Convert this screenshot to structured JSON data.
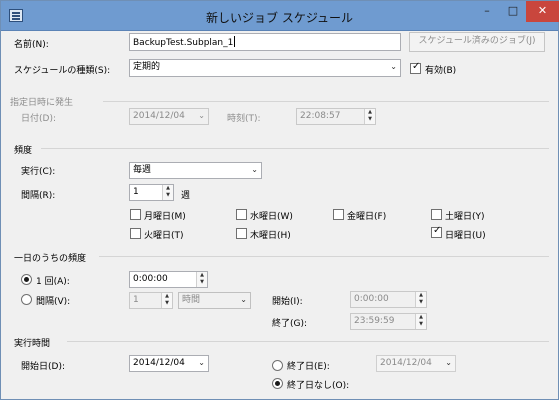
{
  "window": {
    "title": "新しいジョブ スケジュール",
    "minimize": "–",
    "maximize": "□",
    "close": "✕"
  },
  "general": {
    "name_label": "名前(N):",
    "name_value": "BackupTest.Subplan_1",
    "jobs_button": "スケジュール済みのジョブ(J)",
    "type_label": "スケジュールの種類(S):",
    "type_value": "定期的",
    "enabled_label": "有効(B)",
    "enabled_checked": true
  },
  "one_time": {
    "header": "指定日時に発生",
    "date_label": "日付(D):",
    "date_value": "2014/12/04",
    "time_label": "時刻(T):",
    "time_value": "22:08:57"
  },
  "frequency": {
    "header": "頻度",
    "run_label": "実行(C):",
    "run_value": "毎週",
    "interval_label": "間隔(R):",
    "interval_value": "1",
    "interval_unit": "週",
    "days": [
      {
        "label": "月曜日(M)",
        "checked": false
      },
      {
        "label": "水曜日(W)",
        "checked": false
      },
      {
        "label": "金曜日(F)",
        "checked": false
      },
      {
        "label": "土曜日(Y)",
        "checked": false
      },
      {
        "label": "火曜日(T)",
        "checked": false
      },
      {
        "label": "木曜日(H)",
        "checked": false
      },
      {
        "label": "日曜日(U)",
        "checked": true
      }
    ]
  },
  "daily": {
    "header": "一日のうちの頻度",
    "once_label": "1 回(A):",
    "once_value": "0:00:00",
    "once_selected": true,
    "interval_label": "間隔(V):",
    "interval_value": "1",
    "interval_unit": "時間",
    "start_label": "開始(I):",
    "start_value": "0:00:00",
    "end_label": "終了(G):",
    "end_value": "23:59:59"
  },
  "duration": {
    "header": "実行時間",
    "start_label": "開始日(D):",
    "start_value": "2014/12/04",
    "end_date_label": "終了日(E):",
    "end_date_value": "2014/12/04",
    "no_end_label": "終了日なし(O):",
    "no_end_selected": true
  }
}
